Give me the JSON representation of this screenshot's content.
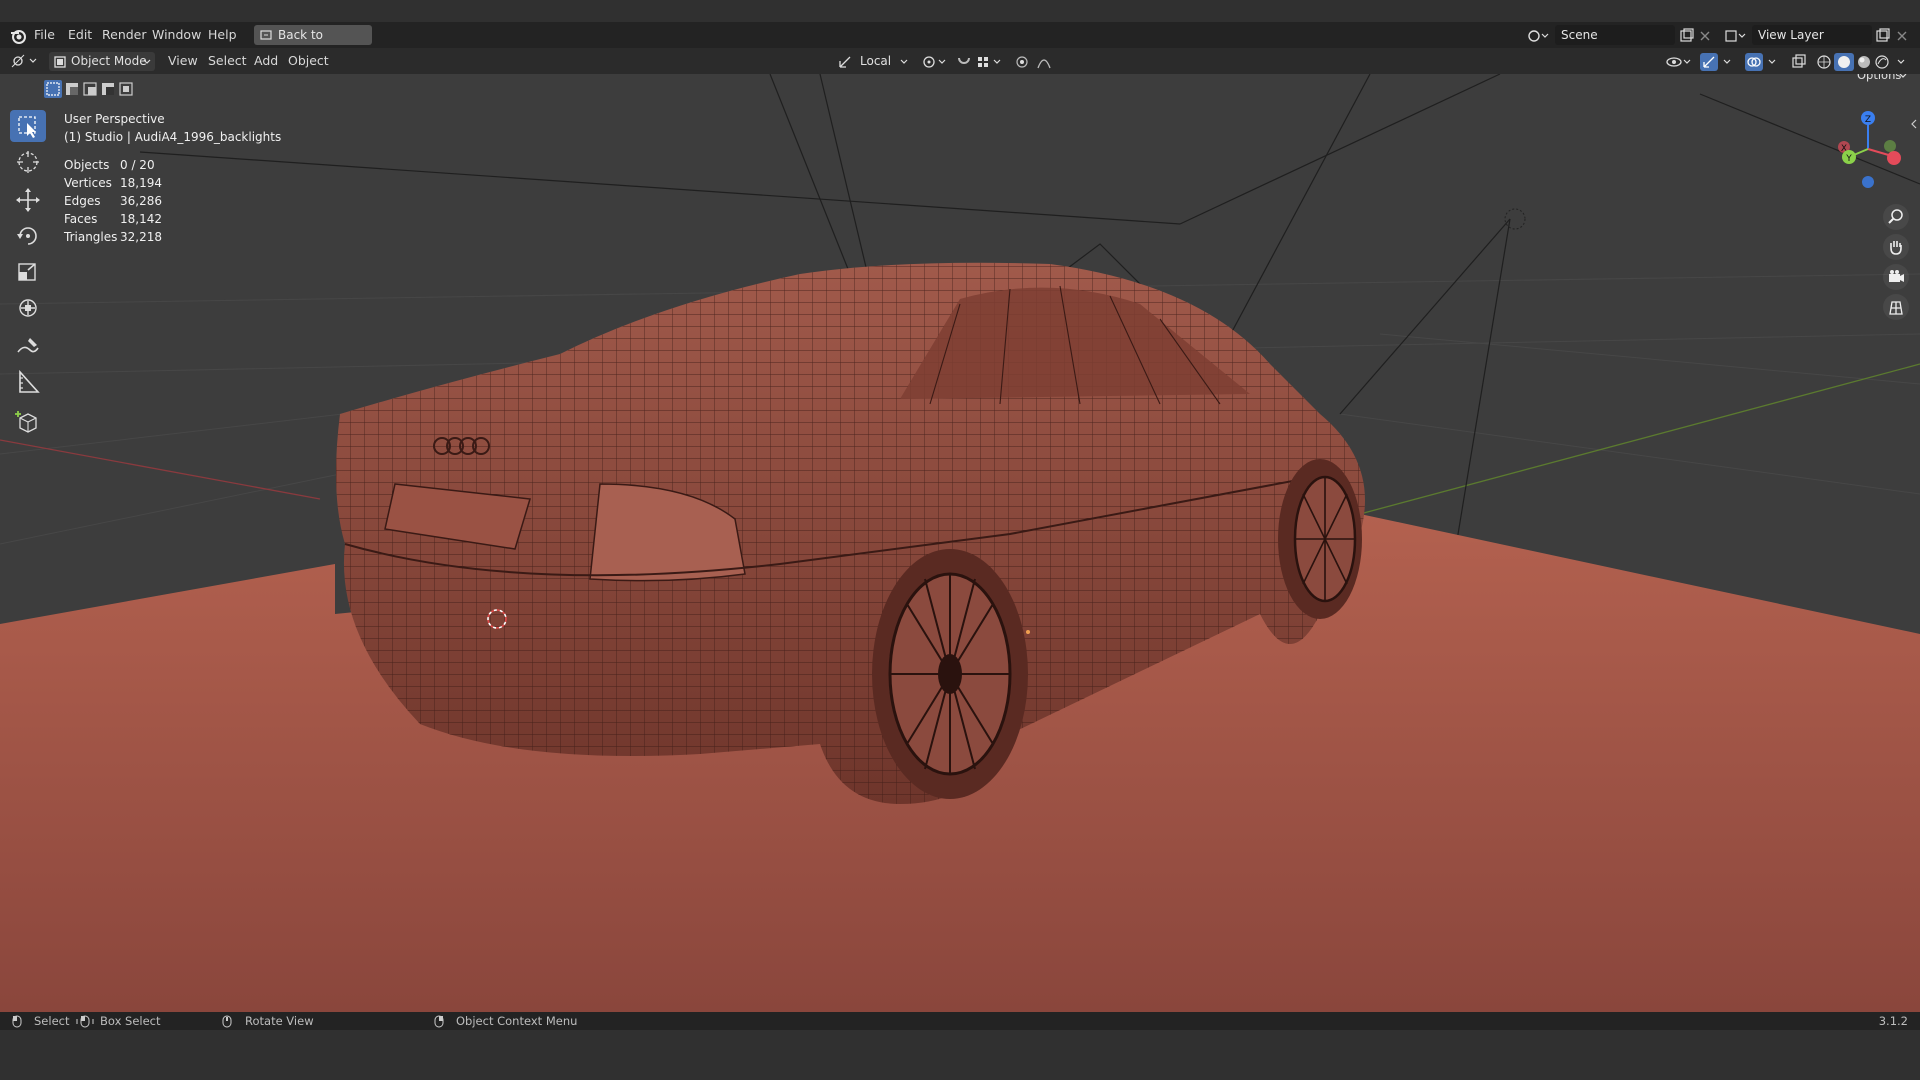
{
  "menus": [
    "File",
    "Edit",
    "Render",
    "Window",
    "Help"
  ],
  "back_button": "Back to Previous",
  "scene": {
    "name": "Scene"
  },
  "view_layer": {
    "name": "View Layer"
  },
  "header": {
    "mode": "Object Mode",
    "menus": [
      "View",
      "Select",
      "Add",
      "Object"
    ],
    "transform_orientation": "Local",
    "options": "Options"
  },
  "overlay": {
    "view_name": "User Perspective",
    "object_name": "(1) Studio | AudiA4_1996_backlights",
    "stats": [
      {
        "label": "Objects",
        "value": "0 / 20"
      },
      {
        "label": "Vertices",
        "value": "18,194"
      },
      {
        "label": "Edges",
        "value": "36,286"
      },
      {
        "label": "Faces",
        "value": "18,142"
      },
      {
        "label": "Triangles",
        "value": "32,218"
      }
    ]
  },
  "gizmo": {
    "x": "X",
    "y": "Y",
    "z": "Z"
  },
  "footer": {
    "select": "Select",
    "box_select": "Box Select",
    "rotate_view": "Rotate View",
    "context_menu": "Object Context Menu",
    "version": "3.1.2"
  },
  "tools": [
    "select-box-icon",
    "cursor-icon",
    "move-icon",
    "rotate-icon",
    "scale-icon",
    "transform-icon",
    "annotate-icon",
    "measure-icon",
    "add-cube-icon"
  ],
  "colors": {
    "accent": "#4772b3",
    "model": "#8b4a3e",
    "floor": "#a85b4d",
    "x_axis": "#e44b5a",
    "y_axis": "#8bd14a",
    "z_axis": "#3a7ff0"
  }
}
